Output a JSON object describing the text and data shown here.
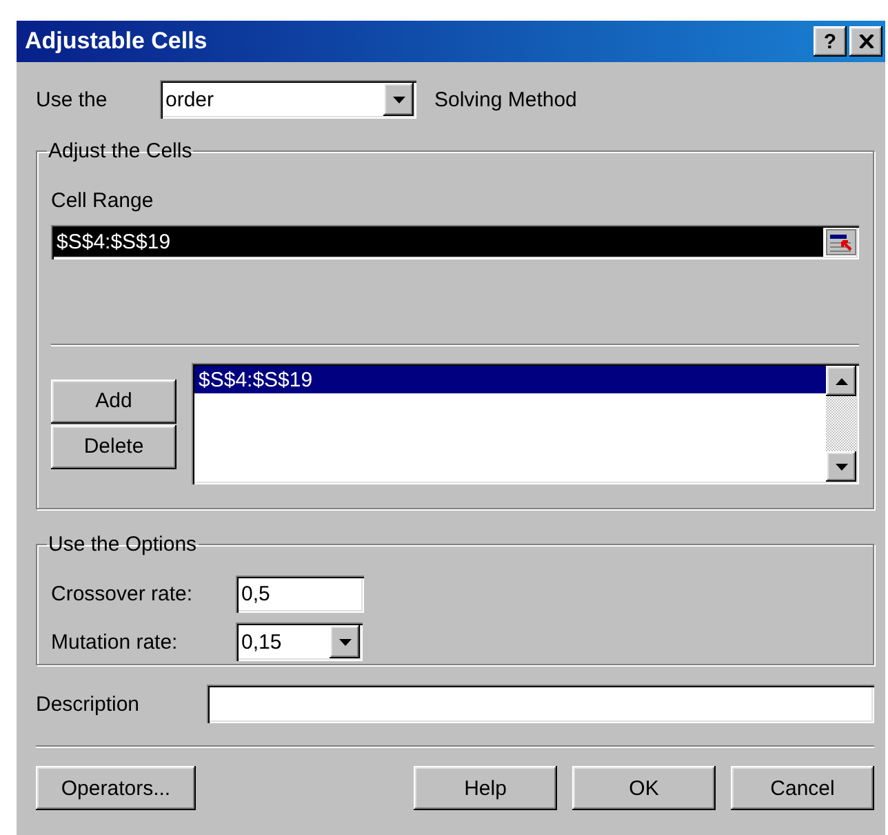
{
  "window": {
    "title": "Adjustable Cells",
    "help_label": "?"
  },
  "method": {
    "label": "Use the",
    "value": "order",
    "suffix": "Solving Method"
  },
  "adjust_group": {
    "title": "Adjust the Cells",
    "cell_range": {
      "label": "Cell Range",
      "value": "$S$4:$S$19",
      "selected": true
    },
    "buttons": [
      "Add",
      "Delete"
    ],
    "list": [
      {
        "text": "$S$4:$S$19",
        "selected": true
      }
    ]
  },
  "options_group": {
    "title": "Use the Options",
    "fields": [
      {
        "kind": "text",
        "label": "Crossover rate:",
        "value": "0,5"
      },
      {
        "kind": "dropdown",
        "label": "Mutation rate:",
        "value": "0,15"
      }
    ]
  },
  "description": {
    "label": "Description"
  },
  "footer": {
    "left": [
      "Operators..."
    ],
    "right": [
      "Help",
      "OK",
      "Cancel"
    ]
  }
}
